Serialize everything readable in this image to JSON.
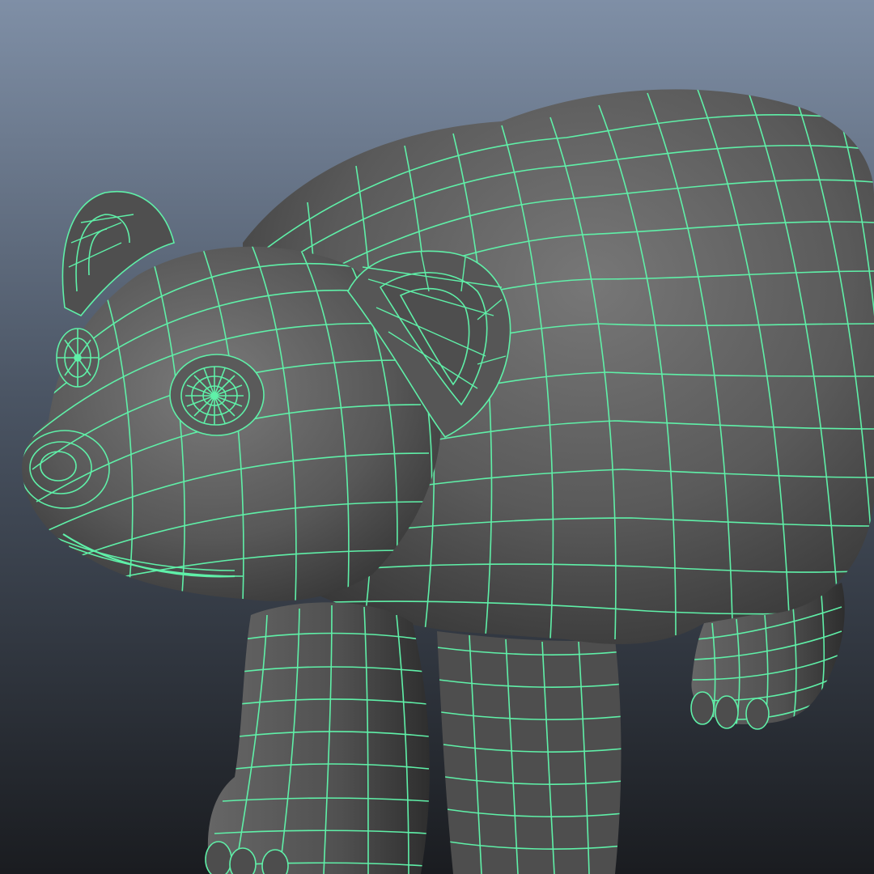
{
  "viewport": {
    "background_top": "#7f8fa6",
    "background_bottom": "#1a1c20",
    "mesh_color": "#5ff0a8",
    "surface_color": "#5e5e5e",
    "surface_highlight": "#7a7a7a",
    "surface_shadow": "#2e2e2e"
  }
}
